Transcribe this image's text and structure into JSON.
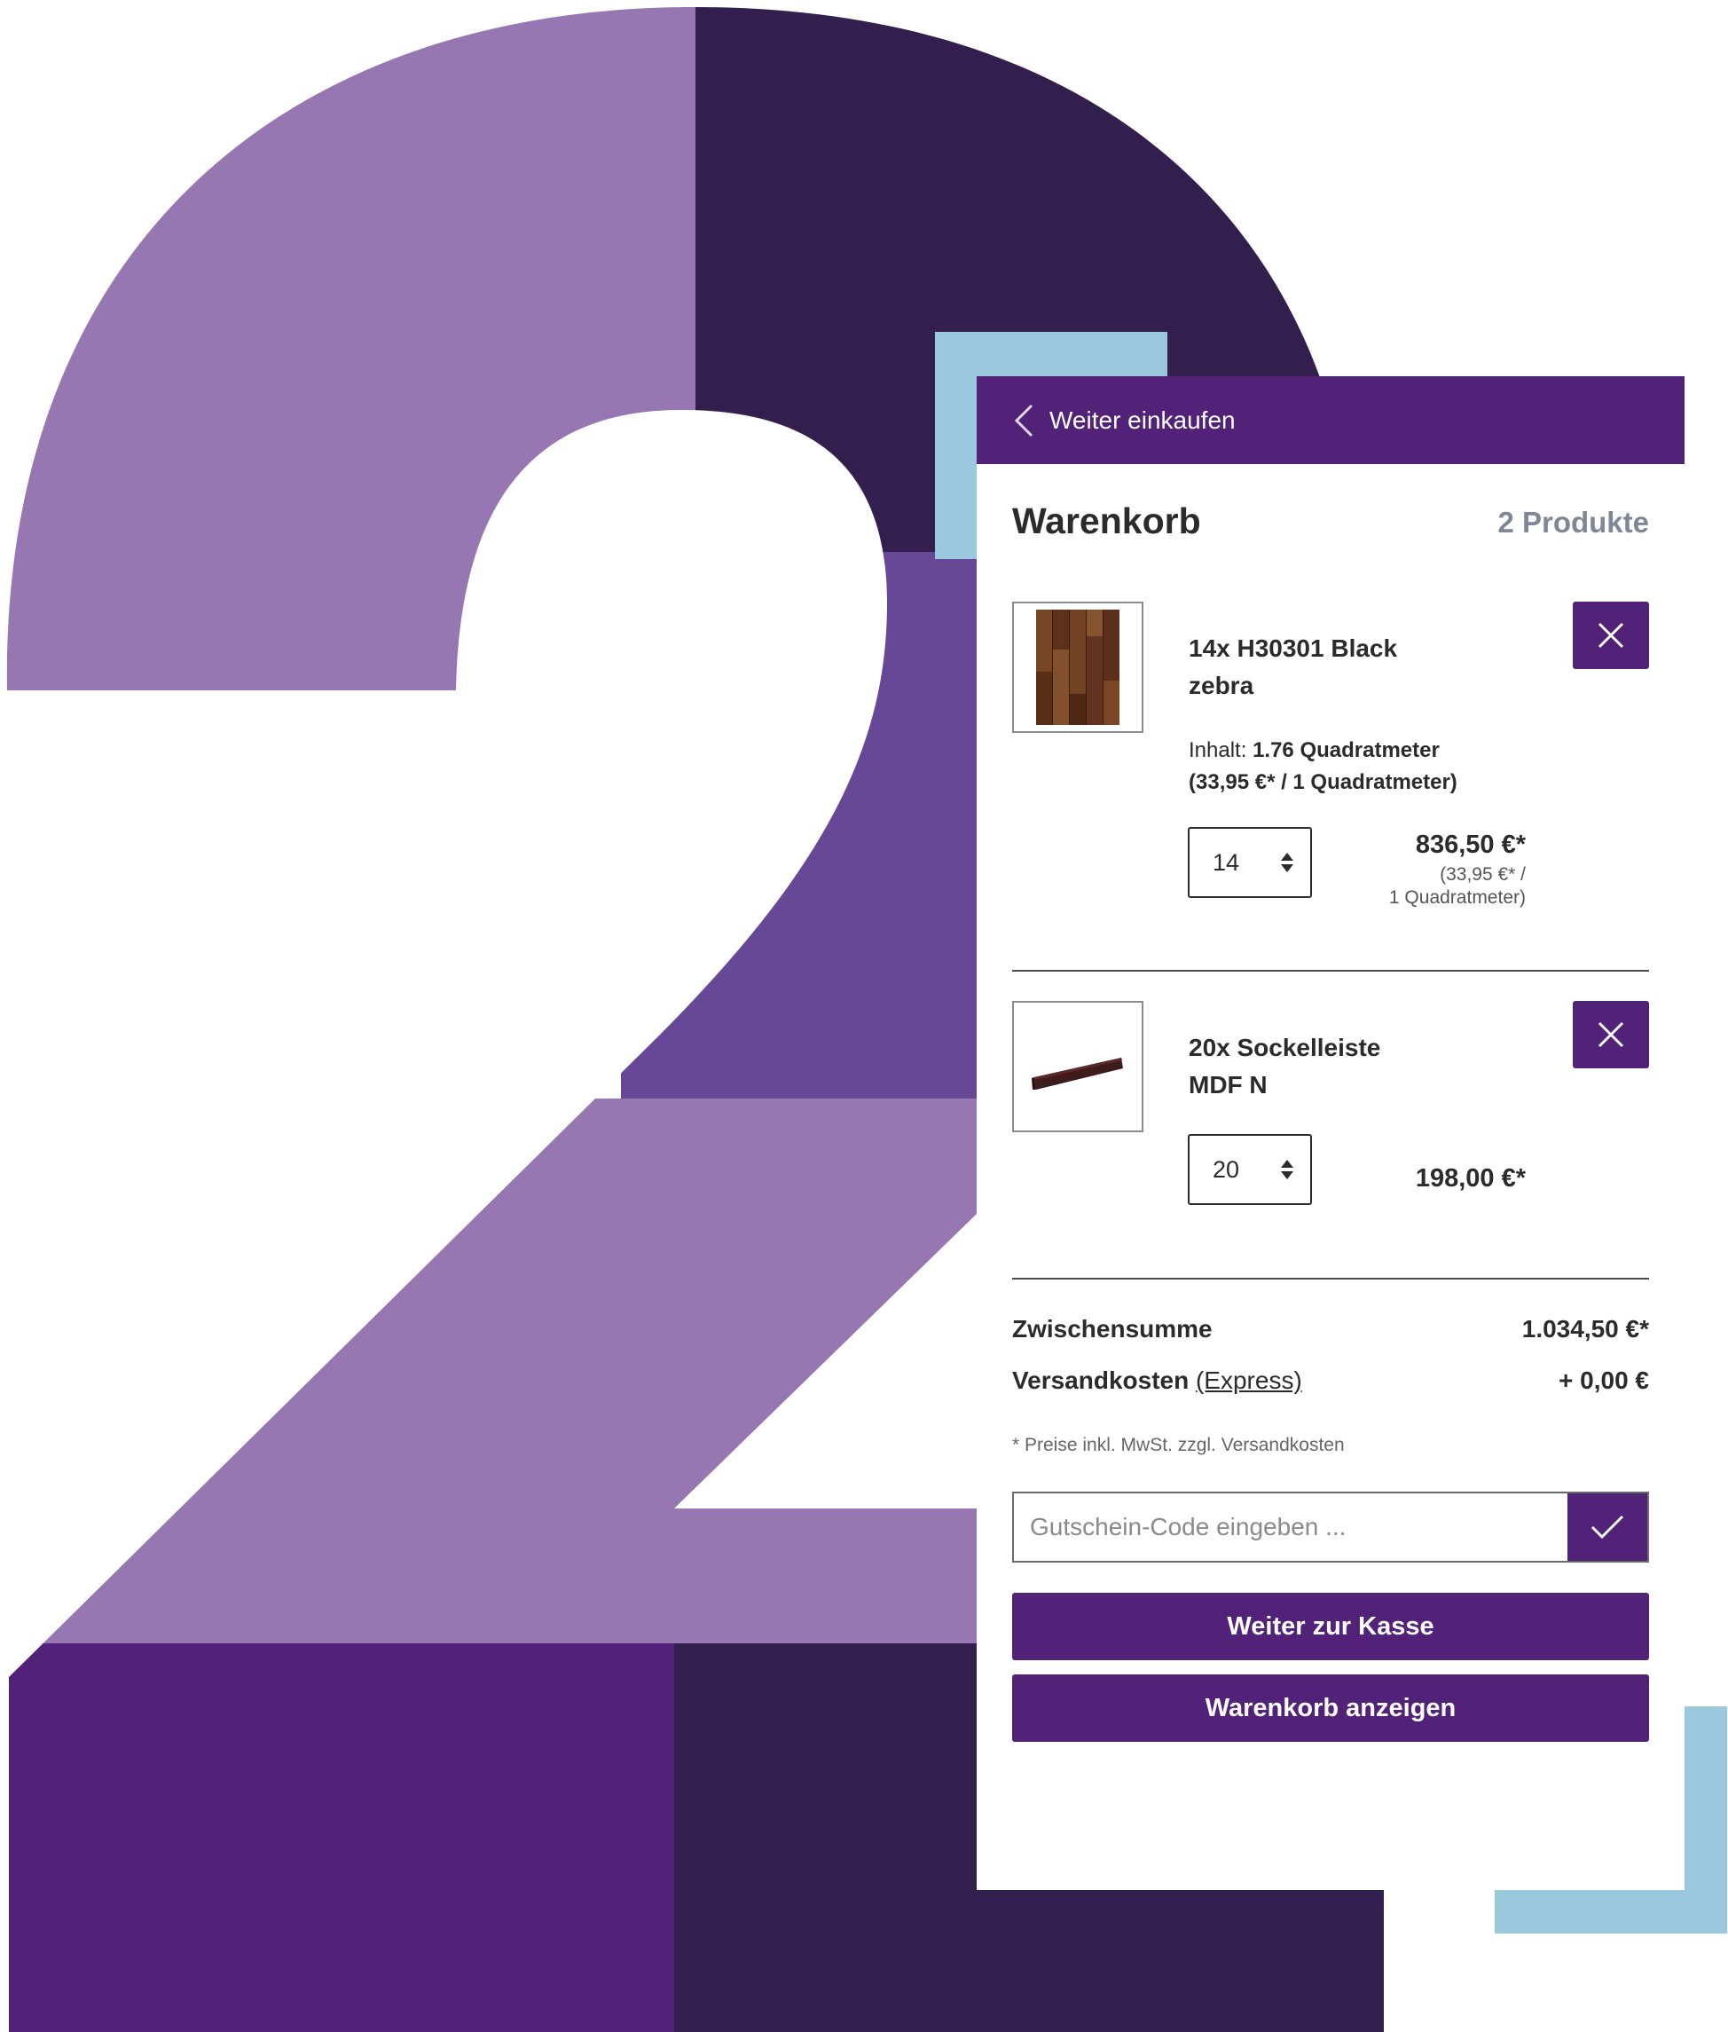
{
  "colors": {
    "brand_purple": "#522178",
    "dark_purple": "#331f4d",
    "light_purple": "#9777b2",
    "medium_purple": "#674896",
    "accent_blue": "#9ac8dd"
  },
  "header": {
    "back_label": "Weiter einkaufen",
    "icon": "chevron-left-icon"
  },
  "cart": {
    "title": "Warenkorb",
    "count_label": "2 Produkte",
    "items": [
      {
        "name_line1": "14x H30301 Black",
        "name_line2": "zebra",
        "content_label": "Inhalt:",
        "content_value": "1.76 Quadratmeter",
        "content_unit_price": "(33,95 €* / 1 Quadratmeter)",
        "quantity": "14",
        "price": "836,50 €*",
        "unit_price_line1": "(33,95 €* /",
        "unit_price_line2": "1 Quadratmeter)"
      },
      {
        "name_line1": "20x Sockelleiste",
        "name_line2": "MDF N",
        "quantity": "20",
        "price": "198,00 €*"
      }
    ]
  },
  "summary": {
    "subtotal_label": "Zwischensumme",
    "subtotal_value": "1.034,50 €*",
    "shipping_label": "Versandkosten",
    "shipping_method": "(Express)",
    "shipping_value": "+ 0,00 €",
    "note": "* Preise inkl. MwSt. zzgl. Versandkosten"
  },
  "voucher": {
    "placeholder": "Gutschein-Code eingeben ..."
  },
  "buttons": {
    "checkout": "Weiter zur Kasse",
    "show_cart": "Warenkorb anzeigen"
  }
}
